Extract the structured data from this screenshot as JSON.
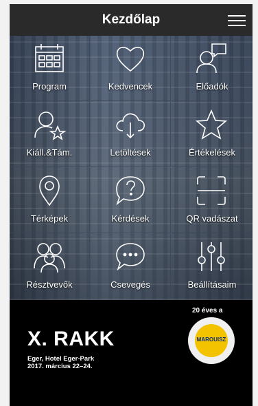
{
  "header": {
    "title": "Kezdőlap",
    "menu_icon": "hamburger-icon"
  },
  "tiles": [
    {
      "label": "Program",
      "icon": "calendar-icon"
    },
    {
      "label": "Kedvencek",
      "icon": "heart-icon"
    },
    {
      "label": "Előadók",
      "icon": "speaker-icon"
    },
    {
      "label": "Kiáll.&Tám.",
      "icon": "person-star-icon"
    },
    {
      "label": "Letöltések",
      "icon": "cloud-download-icon"
    },
    {
      "label": "Értékelések",
      "icon": "star-icon"
    },
    {
      "label": "Térképek",
      "icon": "map-pin-icon"
    },
    {
      "label": "Kérdések",
      "icon": "question-bubble-icon"
    },
    {
      "label": "QR vadászat",
      "icon": "qr-scan-icon"
    },
    {
      "label": "Résztvevők",
      "icon": "people-icon"
    },
    {
      "label": "Csevegés",
      "icon": "chat-icon"
    },
    {
      "label": "Beállításaim",
      "icon": "sliders-icon"
    }
  ],
  "banner": {
    "title": "X. RAKK",
    "line1": "Eger, Hotel Eger-Park",
    "line2": "2017. március 22–24.",
    "years": "20 éves a",
    "badge_text": "MAROUISZ"
  }
}
